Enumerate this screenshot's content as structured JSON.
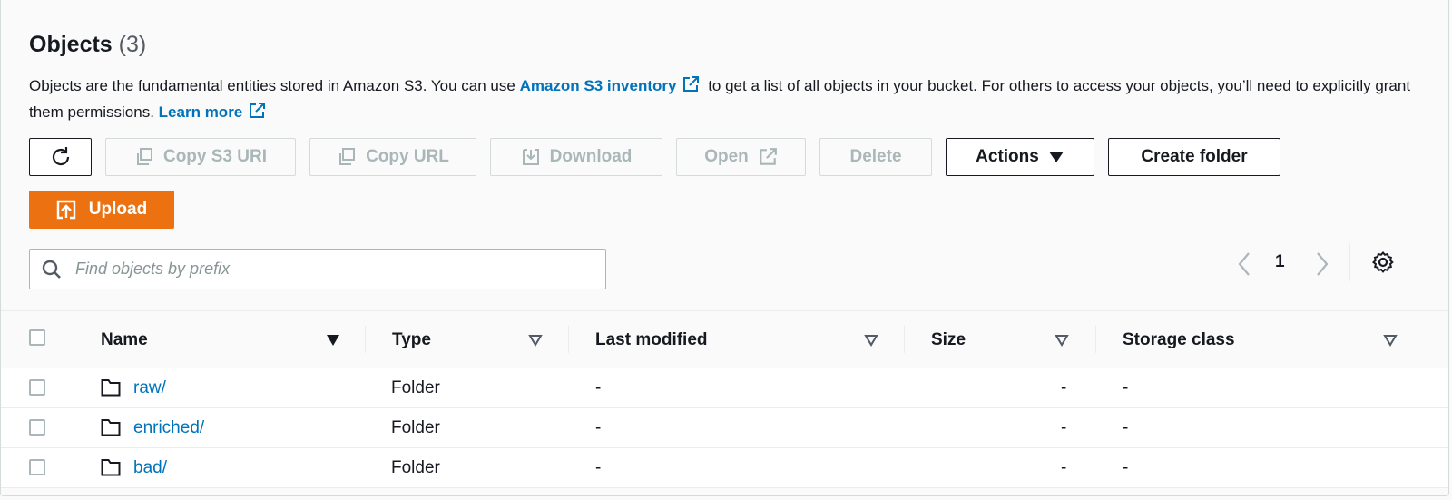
{
  "header": {
    "title": "Objects",
    "count": "(3)"
  },
  "description": {
    "text1": "Objects are the fundamental entities stored in Amazon S3. You can use",
    "link1": "Amazon S3 inventory",
    "text2": "to get a list of all objects in your bucket. For others to access your objects, you’ll need to explicitly grant them permissions.",
    "link2": "Learn more"
  },
  "toolbar": {
    "copy_s3_uri": "Copy S3 URI",
    "copy_url": "Copy URL",
    "download": "Download",
    "open": "Open",
    "delete": "Delete",
    "actions": "Actions",
    "create_folder": "Create folder",
    "upload": "Upload"
  },
  "search": {
    "placeholder": "Find objects by prefix",
    "value": ""
  },
  "pagination": {
    "current_page": "1"
  },
  "table": {
    "columns": [
      "Name",
      "Type",
      "Last modified",
      "Size",
      "Storage class"
    ],
    "rows": [
      {
        "name": "raw/",
        "type": "Folder",
        "last_modified": "-",
        "size": "-",
        "storage_class": "-"
      },
      {
        "name": "enriched/",
        "type": "Folder",
        "last_modified": "-",
        "size": "-",
        "storage_class": "-"
      },
      {
        "name": "bad/",
        "type": "Folder",
        "last_modified": "-",
        "size": "-",
        "storage_class": "-"
      }
    ]
  },
  "colors": {
    "link": "#0073bb",
    "upload_bg": "#ec7211",
    "disabled_text": "#aab7b8",
    "border": "#16191f"
  },
  "icons": [
    "refresh-icon",
    "copy-icon",
    "download-icon",
    "external-link-icon",
    "caret-down-icon",
    "upload-icon",
    "search-icon",
    "chevron-left-icon",
    "chevron-right-icon",
    "gear-icon",
    "folder-icon",
    "sort-icon"
  ]
}
